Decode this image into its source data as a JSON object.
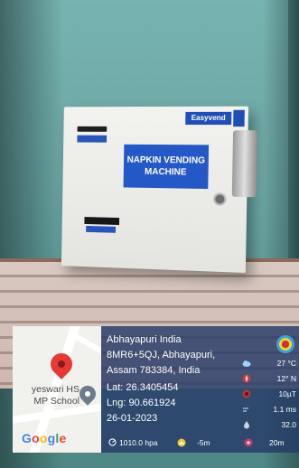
{
  "photo": {
    "machine_brand": "Easyvend",
    "machine_label_line1": "NAPKIN VENDING",
    "machine_label_line2": "MACHINE"
  },
  "overlay": {
    "map": {
      "place_line1": "yeswari HS",
      "place_line2": "MP School",
      "logo_letters": [
        "G",
        "o",
        "o",
        "g",
        "l",
        "e"
      ]
    },
    "location": {
      "title": "Abhayapuri India",
      "address_line1": "8MR6+5QJ, Abhayapuri,",
      "address_line2": "Assam 783384, India",
      "lat": "Lat: 26.3405454",
      "lng": "Lng: 90.661924",
      "date": "26-01-2023"
    },
    "metrics": [
      {
        "icon": "cloud-icon",
        "value": "27 °C",
        "color": "#7fc4ff"
      },
      {
        "icon": "compass-icon",
        "value": "12° N",
        "color": "#d24a4a"
      },
      {
        "icon": "magnet-icon",
        "value": "10µT",
        "color": "#d24a4a"
      },
      {
        "icon": "wind-icon",
        "value": "1.1 ms",
        "color": "#9fb3c8"
      },
      {
        "icon": "humidity-icon",
        "value": "32.0",
        "color": "#9fb3c8"
      }
    ],
    "bottom": {
      "pressure": "1010.0 hpa",
      "altitude": "-5m",
      "accuracy": "20m"
    }
  }
}
